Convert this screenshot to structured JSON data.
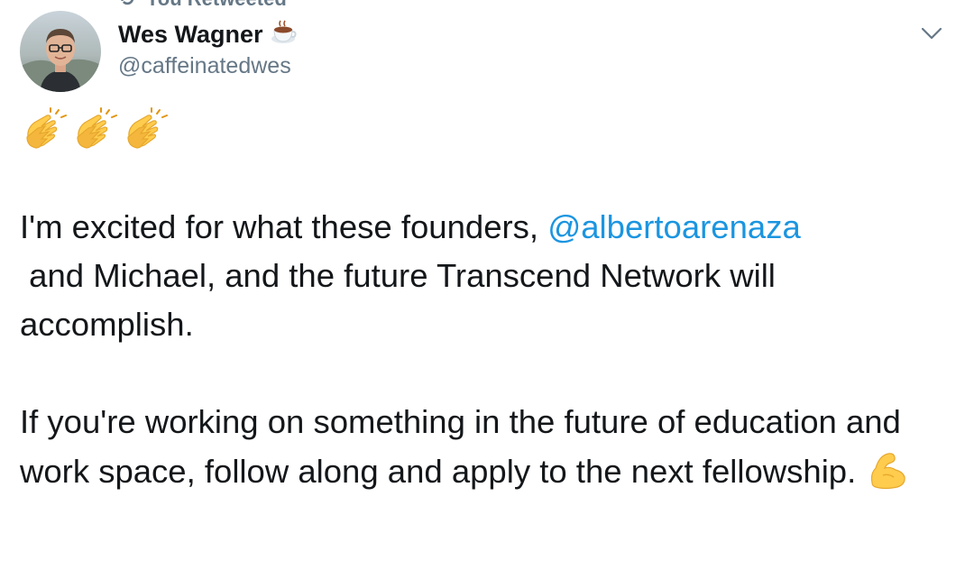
{
  "retweet": {
    "label": "You Retweeted",
    "icon": "retweet-icon"
  },
  "author": {
    "display_name": "Wes Wagner",
    "name_emoji": "coffee-icon",
    "handle": "@caffeinatedwes"
  },
  "menu": {
    "icon": "chevron-down-icon"
  },
  "tweet": {
    "claps": [
      "clapping-hands-icon",
      "clapping-hands-icon",
      "clapping-hands-icon"
    ],
    "line1_text": "I'm excited for what these founders, ",
    "mention": "@albertoarenaza",
    "line2_text": " and Michael, and the future Transcend Network will accomplish.",
    "paragraph2": "If you're working on something in the future of education and work space, follow along and apply to the next fellowship. ",
    "end_emoji": "flexed-biceps-icon"
  },
  "colors": {
    "text": "#14171a",
    "secondary": "#657786",
    "link": "#1b95e0",
    "emoji_yellow": "#ffcc4d"
  }
}
